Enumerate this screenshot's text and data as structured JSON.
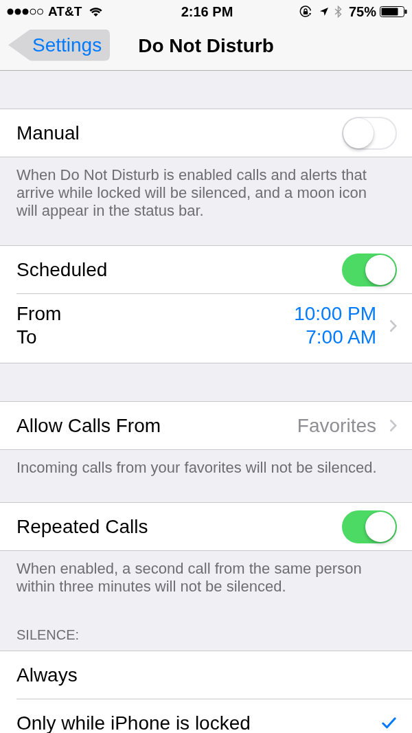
{
  "status_bar": {
    "carrier": "AT&T",
    "time": "2:16 PM",
    "battery": "75%"
  },
  "nav_bar": {
    "back": "Settings",
    "title": "Do Not Disturb"
  },
  "sections": [
    {
      "items": [
        {
          "kind": "toggle",
          "label": "Manual",
          "on": false
        }
      ],
      "footer": "When Do Not Disturb is enabled calls and alerts that arrive while locked will be silenced, and a moon icon will appear in the status bar."
    },
    {
      "items": [
        {
          "kind": "toggle",
          "label": "Scheduled",
          "on": true
        },
        {
          "kind": "range",
          "rows": [
            {
              "label": "From",
              "value": "10:00 PM"
            },
            {
              "label": "To",
              "value": "7:00 AM"
            }
          ]
        }
      ]
    },
    {
      "items": [
        {
          "kind": "disclosure",
          "label": "Allow Calls From",
          "value": "Favorites"
        }
      ],
      "footer": "Incoming calls from your favorites will not be silenced."
    },
    {
      "items": [
        {
          "kind": "toggle",
          "label": "Repeated Calls",
          "on": true
        }
      ],
      "footer": "When enabled, a second call from the same person within three minutes will not be silenced."
    },
    {
      "header": "SILENCE:",
      "items": [
        {
          "kind": "option",
          "label": "Always",
          "selected": false
        },
        {
          "kind": "option",
          "label": "Only while iPhone is locked",
          "selected": true
        }
      ]
    }
  ]
}
